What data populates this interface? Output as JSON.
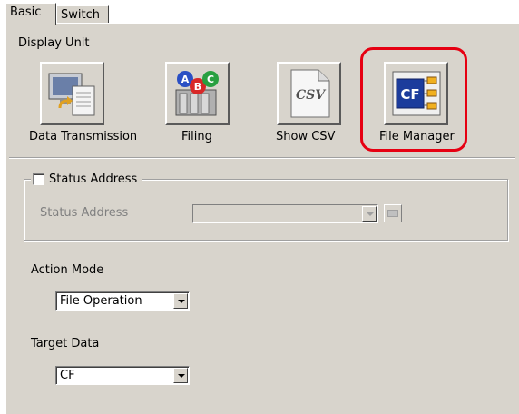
{
  "tabs": [
    {
      "label": "Basic",
      "active": true
    },
    {
      "label": "Switch",
      "active": false
    }
  ],
  "display_unit": {
    "label": "Display Unit",
    "items": [
      {
        "label": "Data Transmission",
        "icon": "data-transmission-icon"
      },
      {
        "label": "Filing",
        "icon": "filing-icon"
      },
      {
        "label": "Show CSV",
        "icon": "csv-icon",
        "icon_text": "CSV"
      },
      {
        "label": "File Manager",
        "icon": "file-manager-icon",
        "icon_text": "CF",
        "selected": true
      }
    ],
    "highlight_color": "#e60012"
  },
  "status_address": {
    "checkbox_label": "Status Address",
    "checked": false,
    "field_label": "Status Address",
    "value": ""
  },
  "action_mode": {
    "label": "Action Mode",
    "value": "File Operation"
  },
  "target_data": {
    "label": "Target Data",
    "value": "CF"
  },
  "colors": {
    "panel": "#d8d4cc",
    "highlight": "#e60012"
  }
}
